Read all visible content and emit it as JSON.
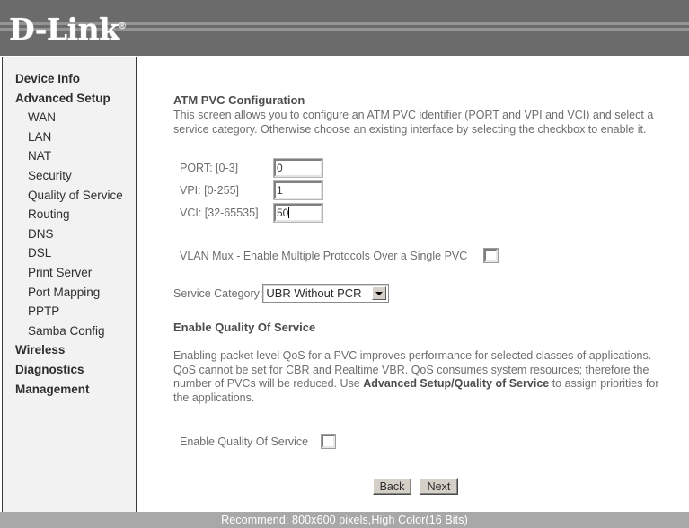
{
  "header": {
    "logo_text": "D-Link",
    "registered_mark": "®"
  },
  "sidebar": {
    "items": [
      {
        "label": "Device Info",
        "level": "top"
      },
      {
        "label": "Advanced Setup",
        "level": "top"
      },
      {
        "label": "WAN",
        "level": "sub"
      },
      {
        "label": "LAN",
        "level": "sub"
      },
      {
        "label": "NAT",
        "level": "sub"
      },
      {
        "label": "Security",
        "level": "sub"
      },
      {
        "label": "Quality of Service",
        "level": "sub"
      },
      {
        "label": "Routing",
        "level": "sub"
      },
      {
        "label": "DNS",
        "level": "sub"
      },
      {
        "label": "DSL",
        "level": "sub"
      },
      {
        "label": "Print Server",
        "level": "sub"
      },
      {
        "label": "Port Mapping",
        "level": "sub"
      },
      {
        "label": "PPTP",
        "level": "sub"
      },
      {
        "label": "Samba Config",
        "level": "sub"
      },
      {
        "label": "Wireless",
        "level": "top"
      },
      {
        "label": "Diagnostics",
        "level": "top"
      },
      {
        "label": "Management",
        "level": "top"
      }
    ]
  },
  "main": {
    "title": "ATM PVC Configuration",
    "description_line1": "This screen allows you to configure an ATM PVC identifier (PORT and VPI and VCI) and select a",
    "description_line2": "service category. Otherwise choose an existing interface by selecting the checkbox to enable it.",
    "fields": [
      {
        "label": "PORT: [0-3]",
        "value": "0",
        "focused": false
      },
      {
        "label": "VPI: [0-255]",
        "value": "1",
        "focused": false
      },
      {
        "label": "VCI: [32-65535]",
        "value": "50",
        "focused": true
      }
    ],
    "vlan_mux": {
      "label": "VLAN Mux - Enable Multiple Protocols Over a Single PVC",
      "checked": false
    },
    "service_category": {
      "label": "Service Category:",
      "selected": "UBR Without PCR"
    },
    "qos": {
      "title": "Enable Quality Of Service",
      "para_part1": "Enabling packet level QoS for a PVC improves performance for selected classes of applications.  QoS cannot be set for CBR and Realtime VBR.  QoS consumes system resources; therefore the number of PVCs will be reduced. Use ",
      "para_bold": "Advanced Setup/Quality of Service",
      "para_part2": " to assign priorities for the applications.",
      "enable_label": "Enable Quality Of Service",
      "enable_checked": false
    },
    "buttons": {
      "back": "Back",
      "next": "Next"
    }
  },
  "footer": {
    "text": "Recommend: 800x600 pixels,High Color(16 Bits)"
  }
}
